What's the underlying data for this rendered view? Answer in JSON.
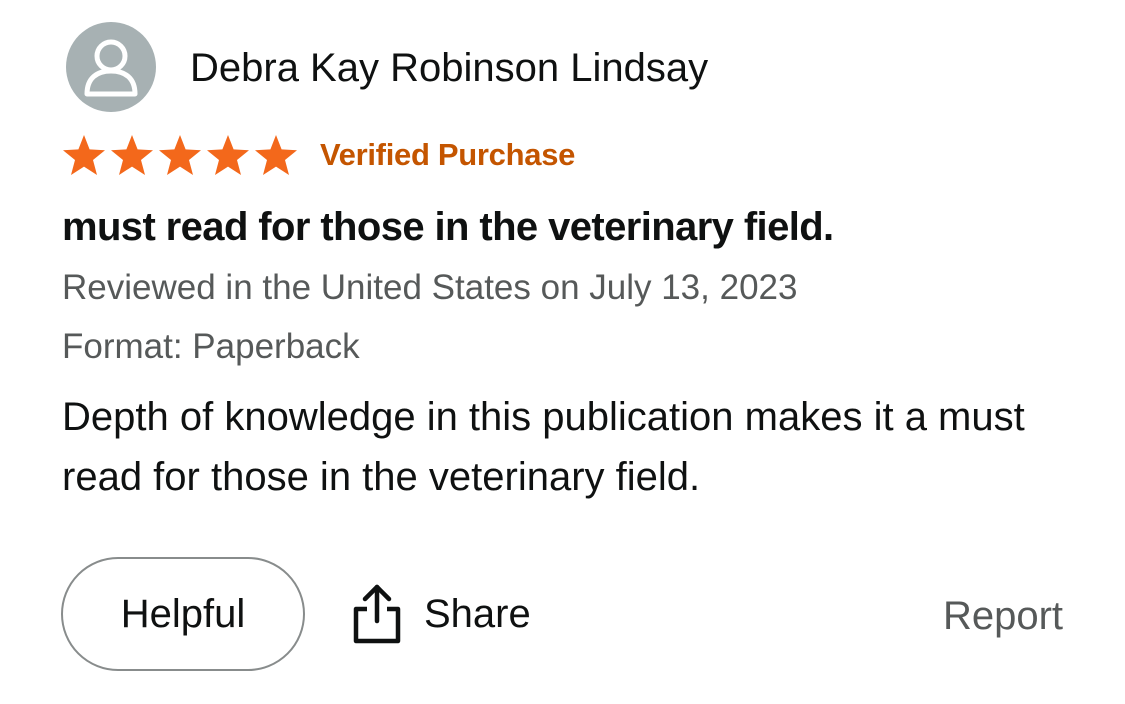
{
  "review": {
    "author": "Debra Kay Robinson Lindsay",
    "avatar_icon": "user-silhouette-icon",
    "rating": 5,
    "rating_max": 5,
    "star_color": "#f3681b",
    "verified_label": "Verified Purchase",
    "verified_color": "#c45500",
    "title": "must read for those in the veterinary field.",
    "date_text": "Reviewed in the United States on July 13, 2023",
    "format_text": "Format: Paperback",
    "body": "Depth of knowledge in this publication makes it a must read for those in the veterinary field."
  },
  "actions": {
    "helpful_label": "Helpful",
    "share_label": "Share",
    "share_icon": "share-upload-icon",
    "report_label": "Report"
  }
}
